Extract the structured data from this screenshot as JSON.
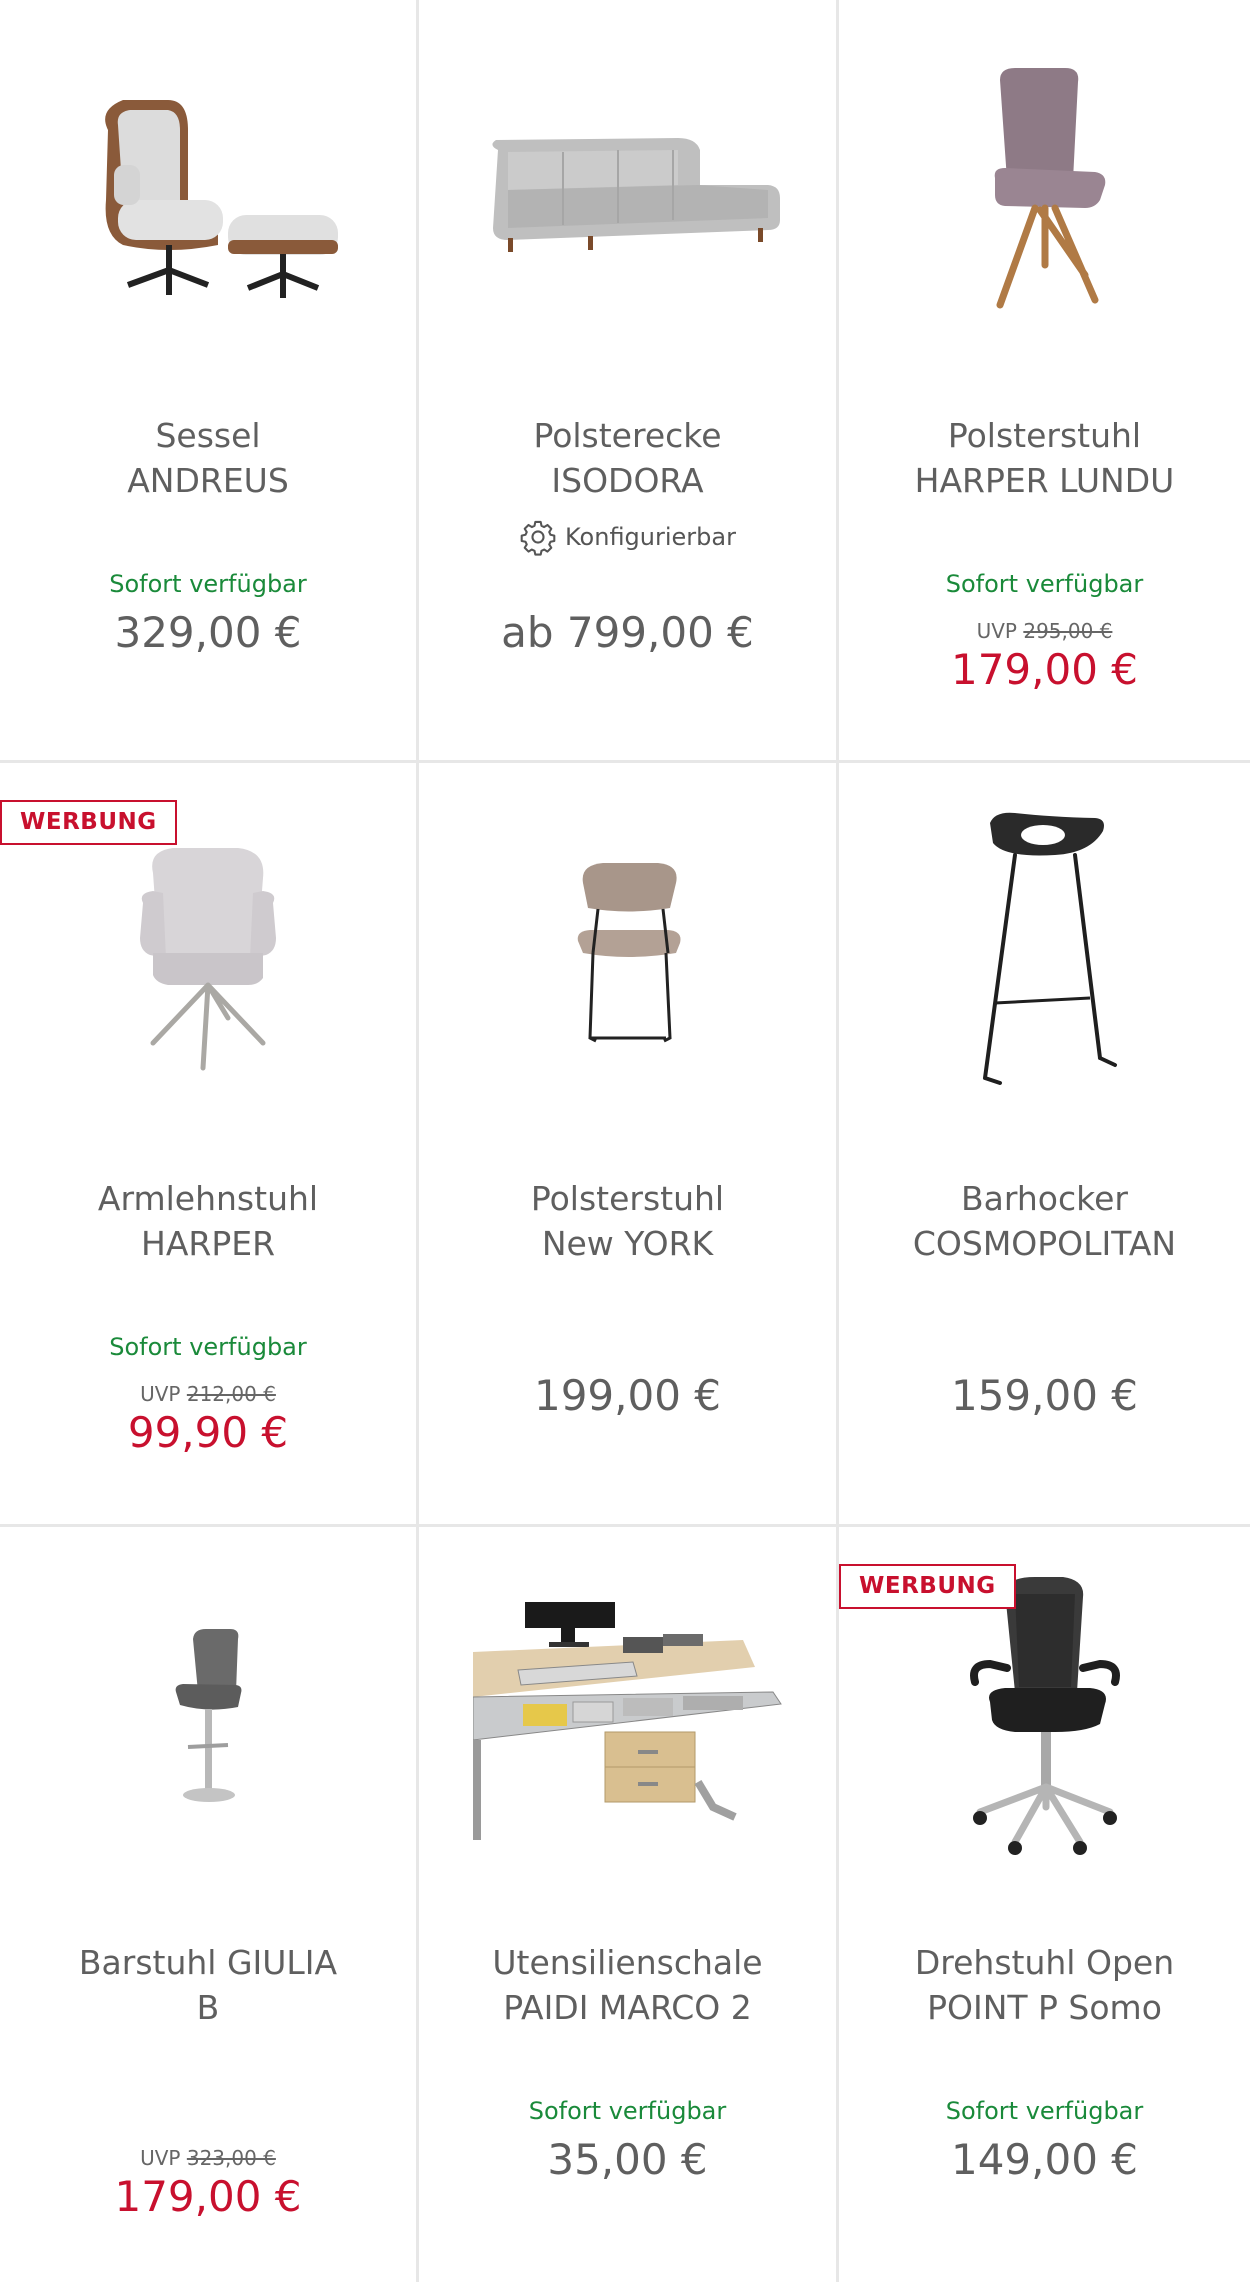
{
  "colors": {
    "accent_red": "#c8102e",
    "available_green": "#1a8a3a",
    "text_gray": "#5f5f5f",
    "divider": "#e7e7e7"
  },
  "products": [
    {
      "title": "Sessel\nANDREUS",
      "availability": "Sofort verfügbar",
      "price": "329,00 €",
      "image": "lounge-chair-with-ottoman"
    },
    {
      "title": "Polsterecke\nISODORA",
      "configurable": "Konfigurierbar",
      "config_icon": "gear-icon",
      "price": "ab 799,00 €",
      "image": "corner-sofa"
    },
    {
      "title": "Polsterstuhl\nHARPER LUNDU",
      "availability": "Sofort verfügbar",
      "uvp_label": "UVP",
      "uvp_price": "295,00 €",
      "price": "179,00 €",
      "image": "upholstered-chair-wood-legs"
    },
    {
      "badge": "WERBUNG",
      "title": "Armlehnstuhl\nHARPER",
      "availability": "Sofort verfügbar",
      "uvp_label": "UVP",
      "uvp_price": "212,00 €",
      "price": "99,90 €",
      "image": "armchair-metal-legs"
    },
    {
      "title": "Polsterstuhl\nNew YORK",
      "price": "199,00 €",
      "image": "dining-chair-sled-base"
    },
    {
      "title": "Barhocker\nCOSMOPOLITAN",
      "price": "159,00 €",
      "image": "bar-stool-black"
    },
    {
      "title": "Barstuhl GIULIA\nB",
      "uvp_label": "UVP",
      "uvp_price": "323,00 €",
      "price": "179,00 €",
      "image": "bar-stool-gray"
    },
    {
      "title": "Utensilienschale\nPAIDI MARCO 2",
      "availability": "Sofort verfügbar",
      "price": "35,00 €",
      "image": "desk-utensil-tray"
    },
    {
      "badge": "WERBUNG",
      "title": "Drehstuhl Open\nPOINT P Somo",
      "availability": "Sofort verfügbar",
      "price": "149,00 €",
      "image": "office-swivel-chair"
    }
  ]
}
